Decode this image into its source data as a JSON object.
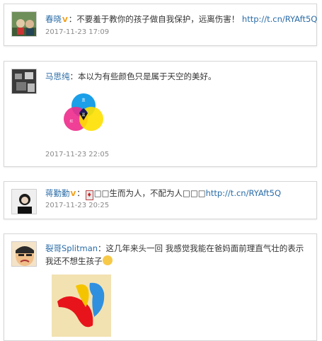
{
  "posts": [
    {
      "username": "春晓",
      "verified_badge": "V",
      "text_prefix": "：不要羞于教你的孩子做自我保护，远离伤害！",
      "link": "http://t.cn/RYAft5Q",
      "time": "2017-11-23 17:09"
    },
    {
      "username": "马思纯",
      "text": "：本以为有些颜色只是属于天空的美好。",
      "time": "2017-11-23 22:05",
      "image": {
        "circle_labels": [
          "蓝",
          "黑",
          "红"
        ],
        "colors": [
          "#1a9fe8",
          "#ee2a8b",
          "#ffe000"
        ]
      }
    },
    {
      "username": "蒋勤勤",
      "verified_badge": "V",
      "text_prefix": "：",
      "text_mid": "□□生而为人，不配为人□□□",
      "link": "http://t.cn/RYAft5Q",
      "time": "2017-11-23 20:25"
    },
    {
      "username": "裂哥Splitman",
      "text": "：这几年来头一回 我感觉我能在爸妈面前理直气壮的表示我还不想生孩子",
      "image": {
        "colors": [
          "#e8141b",
          "#f5c400",
          "#2f90e0"
        ]
      }
    }
  ],
  "colors": {
    "name": "#2a6ca7",
    "time": "#8a8a8a",
    "border": "#d6d6d6"
  }
}
